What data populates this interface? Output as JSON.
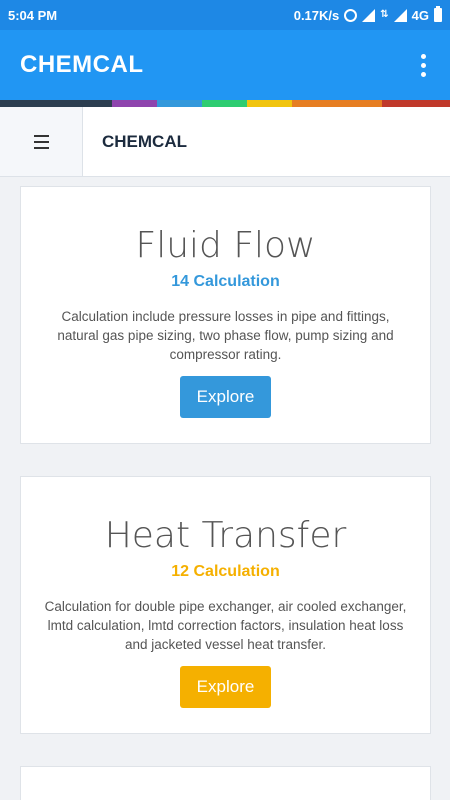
{
  "statusbar": {
    "time": "5:04 PM",
    "speed": "0.17K/s",
    "network": "4G",
    "icons": [
      "alarm-icon",
      "data-arrows-icon",
      "signal-icon",
      "signal-icon",
      "battery-icon"
    ]
  },
  "appbar": {
    "title": "CHEMCAL",
    "menu_icon": "more-vert-icon"
  },
  "colorstrip": [
    "#2c3e50",
    "#8e44ad",
    "#3498db",
    "#2ecc71",
    "#f1c40f",
    "#e67e22",
    "#c0392b"
  ],
  "navbar": {
    "menu_icon": "hamburger-icon",
    "title": "CHEMCAL"
  },
  "cards": [
    {
      "title": "Fluid Flow",
      "count": "14 Calculation",
      "description": "Calculation include pressure losses in pipe and fittings, natural gas pipe sizing, two phase flow, pump sizing and compressor rating.",
      "button": "Explore",
      "accent": "#3498db"
    },
    {
      "title": "Heat Transfer",
      "count": "12 Calculation",
      "description": "Calculation for double pipe exchanger, air cooled exchanger, lmtd calculation, lmtd correction factors, insulation heat loss and jacketed vessel heat transfer.",
      "button": "Explore",
      "accent": "#f5b000"
    }
  ]
}
